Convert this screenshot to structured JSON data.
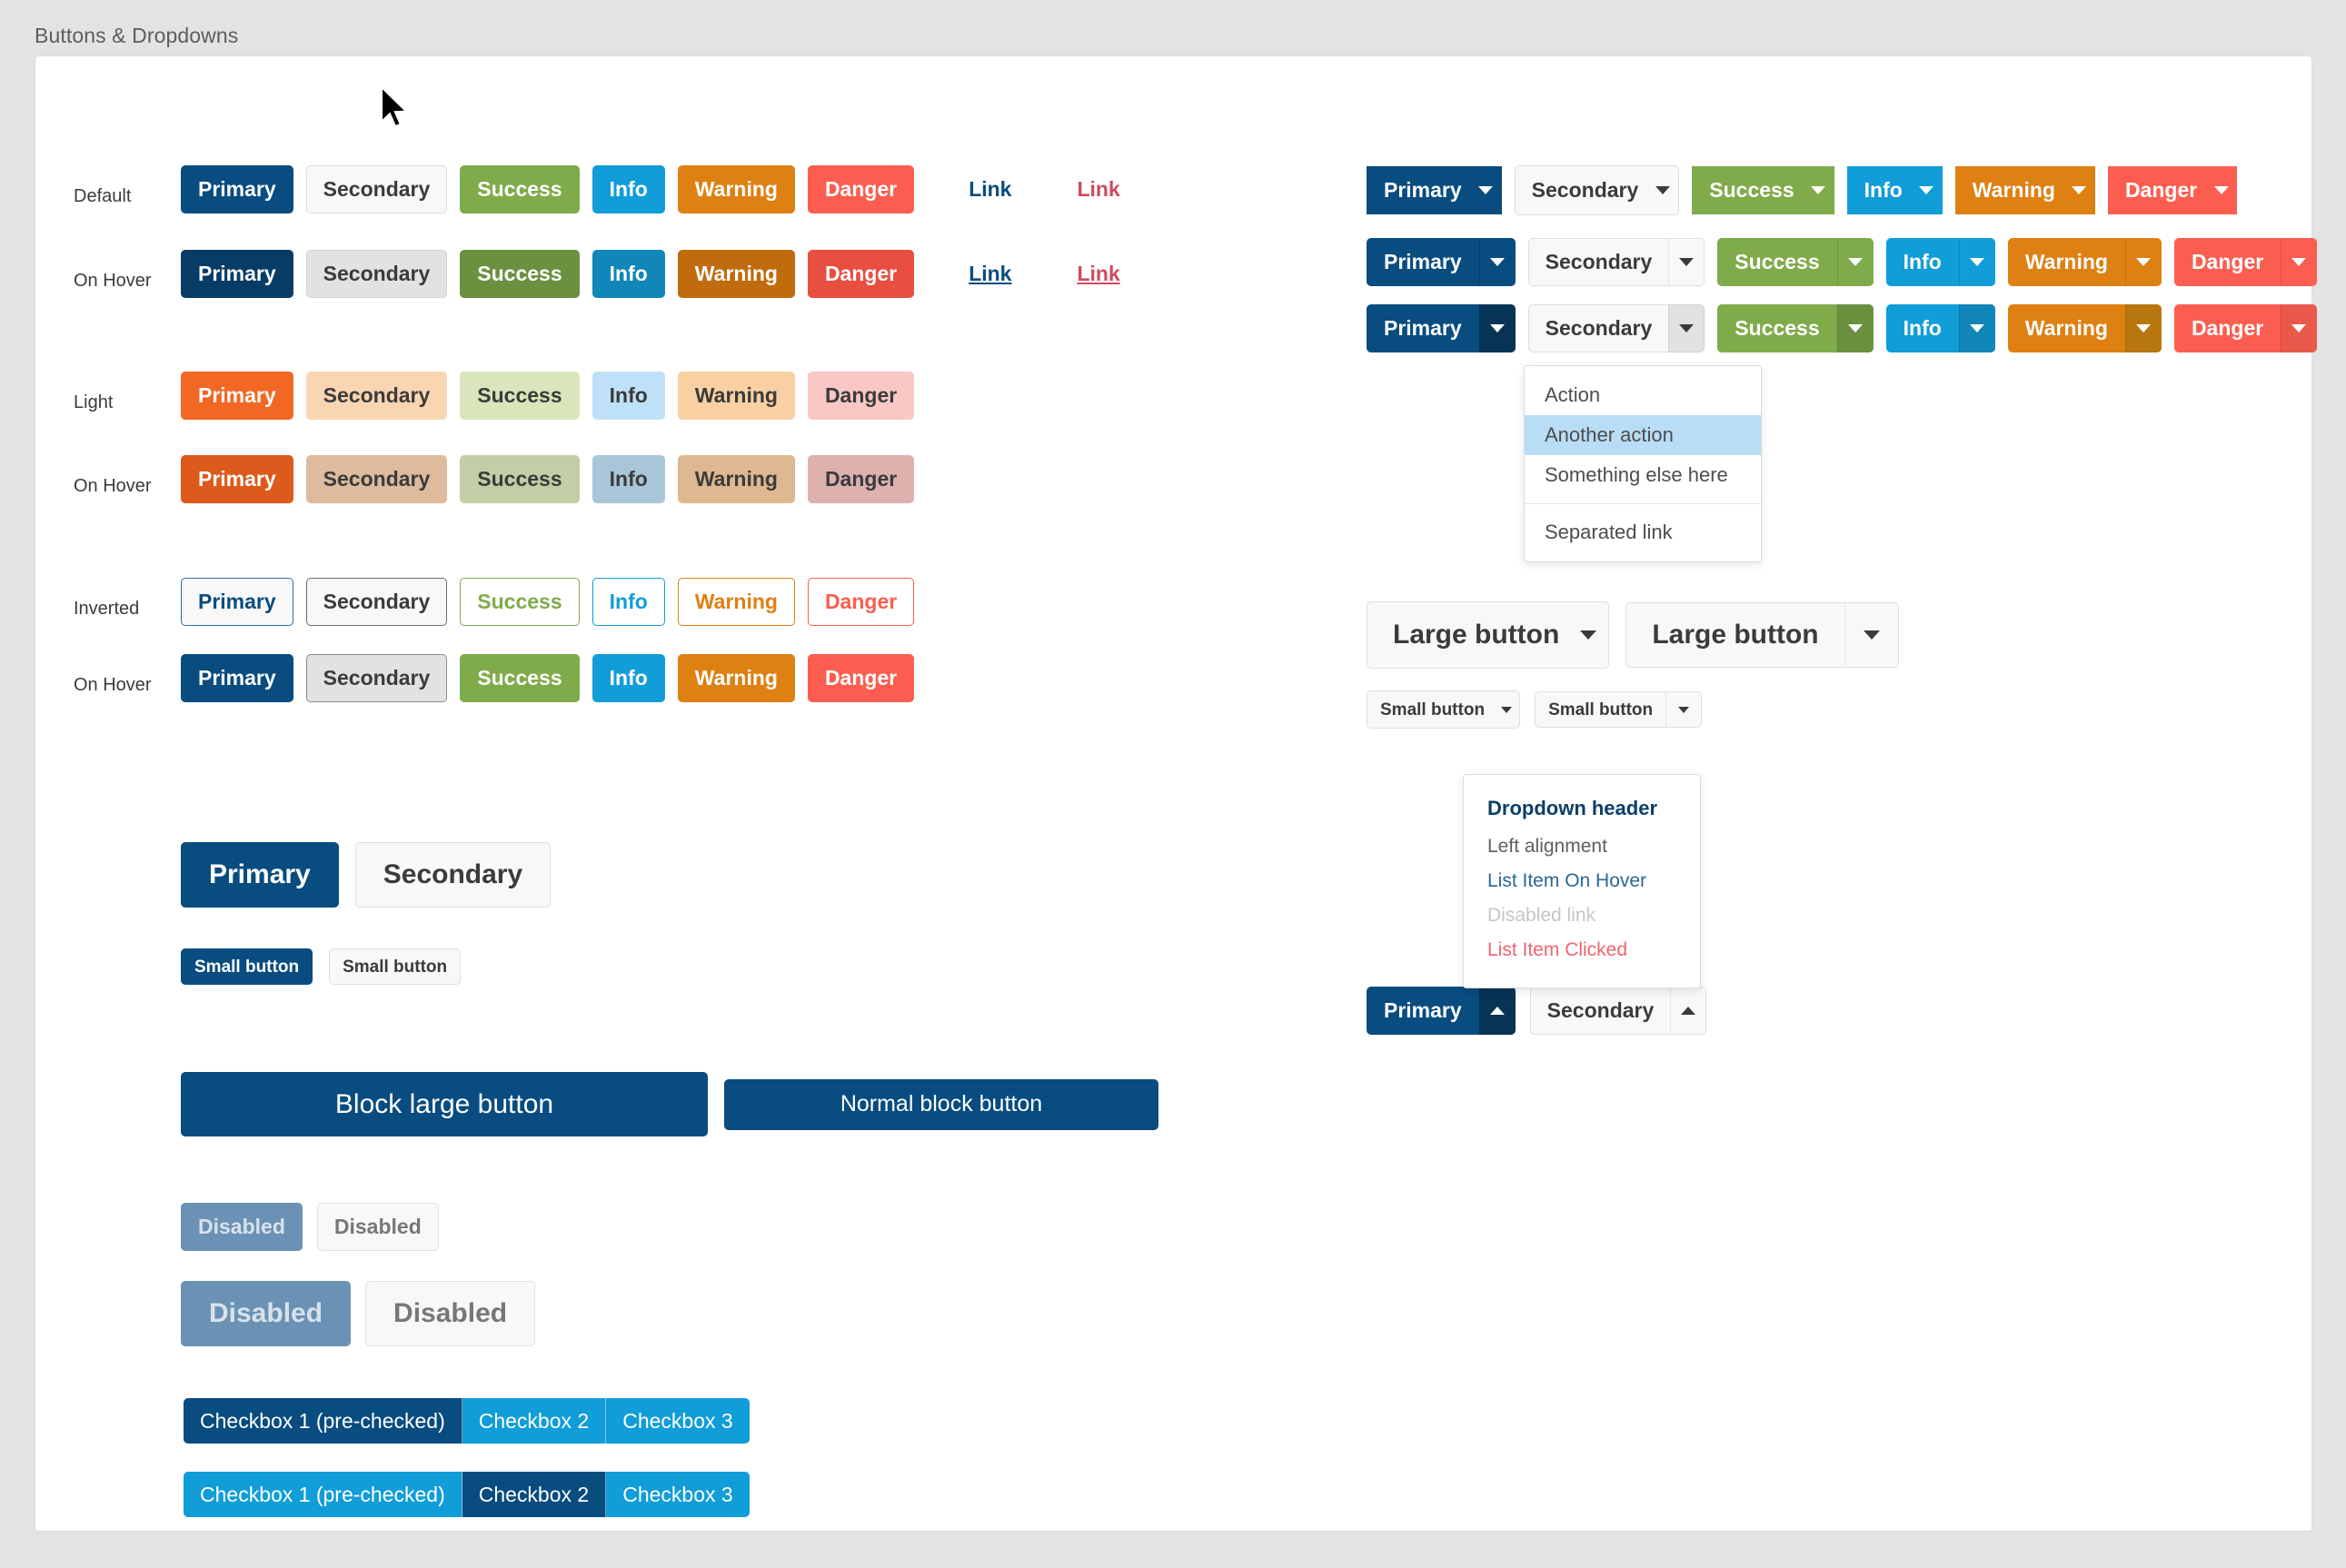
{
  "page": {
    "title": "Buttons & Dropdowns"
  },
  "colors": {
    "primary": "#084c80",
    "secondary": "#f8f8f8",
    "success": "#7fab4a",
    "info": "#119dd8",
    "warning": "#df8013",
    "danger": "#fb5e50",
    "light_primary": "#f26724",
    "link": "#084c80",
    "link_alt": "#cf4a5e",
    "menu_highlight": "#b8ddf5",
    "page_background": "#e3e3e3",
    "card_background": "#ffffff"
  },
  "button_labels": {
    "primary": "Primary",
    "secondary": "Secondary",
    "success": "Success",
    "info": "Info",
    "warning": "Warning",
    "danger": "Danger",
    "link": "Link"
  },
  "row_labels": {
    "default": "Default",
    "hover1": "On Hover",
    "light": "Light",
    "hover2": "On Hover",
    "inverted": "Inverted",
    "hover3": "On Hover"
  },
  "sizes": {
    "large_button": "Large button",
    "small_button": "Small button",
    "block_large": "Block large button",
    "block_normal": "Normal block button",
    "disabled": "Disabled"
  },
  "dropdown_menu": {
    "items": [
      {
        "label": "Action",
        "state": "normal"
      },
      {
        "label": "Another action",
        "state": "hover"
      },
      {
        "label": "Something else here",
        "state": "normal"
      },
      {
        "label": "Separated link",
        "state": "separated"
      }
    ]
  },
  "dropdown_panel": {
    "header": "Dropdown header",
    "items": [
      {
        "label": "Left alignment",
        "state": "normal"
      },
      {
        "label": "List Item On Hover",
        "state": "hover"
      },
      {
        "label": "Disabled link",
        "state": "disabled"
      },
      {
        "label": "List Item Clicked",
        "state": "clicked"
      }
    ]
  },
  "checkbox_group": {
    "items": [
      {
        "label": "Checkbox 1 (pre-checked)"
      },
      {
        "label": "Checkbox 2"
      },
      {
        "label": "Checkbox 3"
      }
    ],
    "row1_selected_index": 0,
    "row2_selected_index": 1
  }
}
